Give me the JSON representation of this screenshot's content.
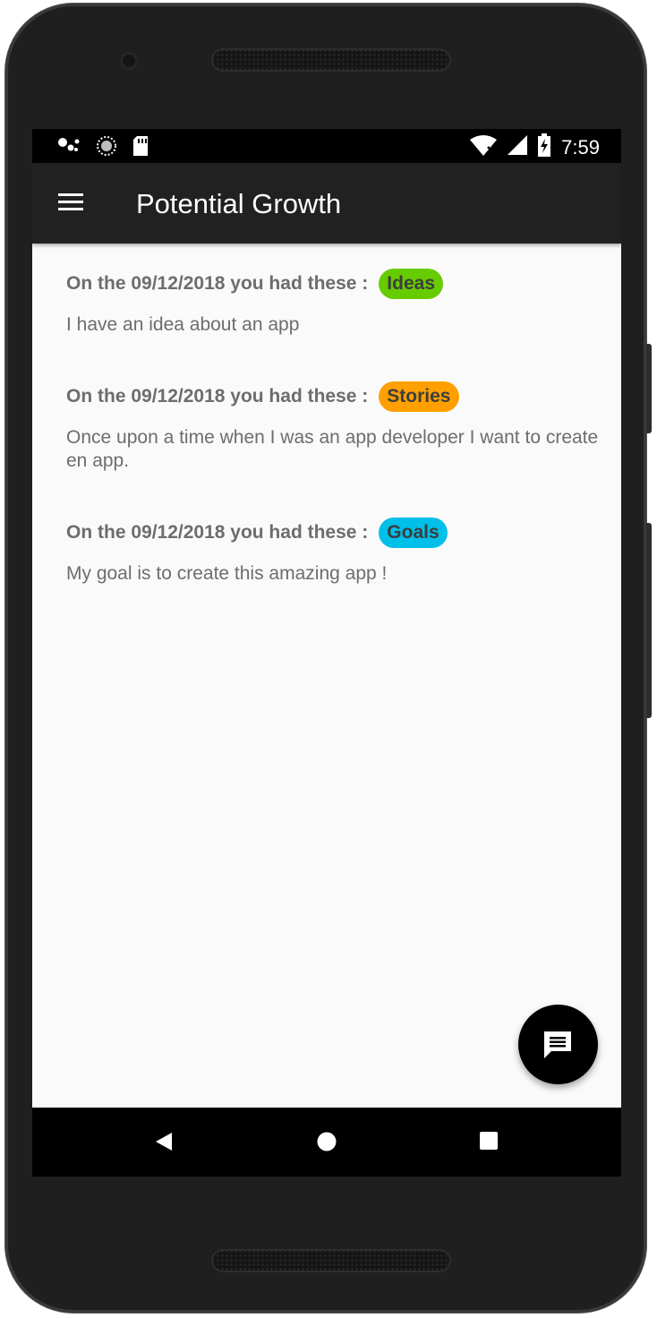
{
  "status_bar": {
    "time": "7:59",
    "left_icons": [
      "assistant-dots-icon",
      "sync-progress-icon",
      "sd-card-icon"
    ],
    "right_icons": [
      "wifi-icon",
      "signal-icon",
      "battery-charging-icon"
    ]
  },
  "app_bar": {
    "title": "Potential Growth",
    "menu_icon": "hamburger-menu-icon"
  },
  "entries": [
    {
      "date_text": "On the 09/12/2018 you had these :",
      "badge": "Ideas",
      "badge_color": "#66cc00",
      "text": "I have an idea about an app"
    },
    {
      "date_text": "On the 09/12/2018 you had these :",
      "badge": "Stories",
      "badge_color": "#ffa000",
      "text": "Once upon a time when I was an app developer I want to create en app."
    },
    {
      "date_text": "On the 09/12/2018 you had these :",
      "badge": "Goals",
      "badge_color": "#00bfe8",
      "text": "My goal is to create this amazing app !"
    }
  ],
  "fab": {
    "icon": "message-icon"
  },
  "nav_bar": {
    "icons": [
      "back-icon",
      "home-icon",
      "recents-icon"
    ]
  }
}
